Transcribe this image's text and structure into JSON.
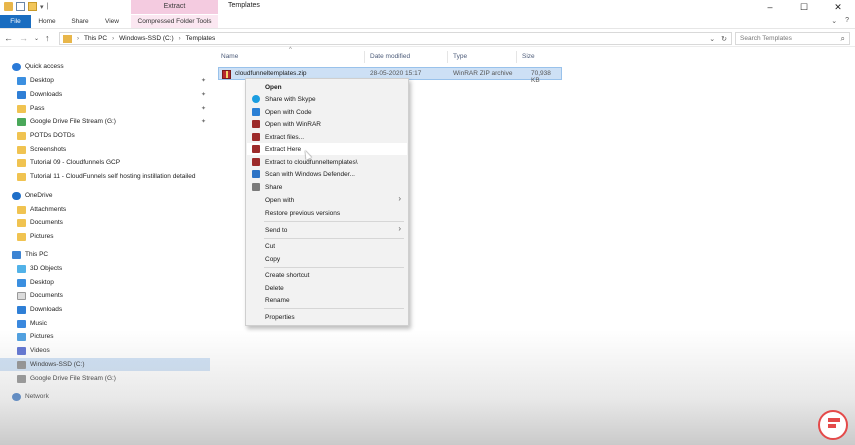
{
  "titlebar": {
    "tool_tab_title": "Extract",
    "window_title": "Templates",
    "qat_icons": [
      "folder-icon",
      "properties-icon",
      "new-folder-icon"
    ],
    "controls": [
      "minimize-icon",
      "maximize-icon",
      "close-icon"
    ]
  },
  "ribbon": {
    "tabs": {
      "file": "File",
      "home": "Home",
      "share": "Share",
      "view": "View",
      "compressed_tools": "Compressed Folder Tools"
    },
    "controls": [
      "expand-ribbon-icon",
      "help-icon"
    ]
  },
  "address": {
    "crumbs": [
      "This PC",
      "Windows-SSD (C:)",
      "Templates"
    ],
    "search_placeholder": "Search Templates"
  },
  "navpane": {
    "quick_access": "Quick access",
    "quick_items": [
      "Desktop",
      "Downloads",
      "Pass",
      "Google Drive File Stream (G:)",
      "POTDs DOTDs",
      "Screenshots",
      "Tutorial 09 - Cloudfunnels GCP",
      "Tutorial 11 - CloudFunnels self hosting instillation detailed"
    ],
    "onedrive": "OneDrive",
    "onedrive_items": [
      "Attachments",
      "Documents",
      "Pictures"
    ],
    "this_pc": "This PC",
    "pc_items": [
      "3D Objects",
      "Desktop",
      "Documents",
      "Downloads",
      "Music",
      "Pictures",
      "Videos",
      "Windows-SSD (C:)",
      "Google Drive File Stream (G:)"
    ],
    "network": "Network"
  },
  "filelist": {
    "headers": {
      "name": "Name",
      "date": "Date modified",
      "type": "Type",
      "size": "Size"
    },
    "file": {
      "name": "cloudfunneltemplates.zip",
      "date": "28-05-2020 15:17",
      "type": "WinRAR ZIP archive",
      "size": "70,938 KB"
    }
  },
  "context_menu": {
    "open": "Open",
    "share_skype": "Share with Skype",
    "open_code": "Open with Code",
    "open_winrar": "Open with WinRAR",
    "extract_files": "Extract files...",
    "extract_here": "Extract Here",
    "extract_to": "Extract to cloudfunneltemplates\\",
    "scan_defender": "Scan with Windows Defender...",
    "share": "Share",
    "open_with": "Open with",
    "restore": "Restore previous versions",
    "send_to": "Send to",
    "cut": "Cut",
    "copy": "Copy",
    "create_shortcut": "Create shortcut",
    "delete": "Delete",
    "rename": "Rename",
    "properties": "Properties"
  }
}
